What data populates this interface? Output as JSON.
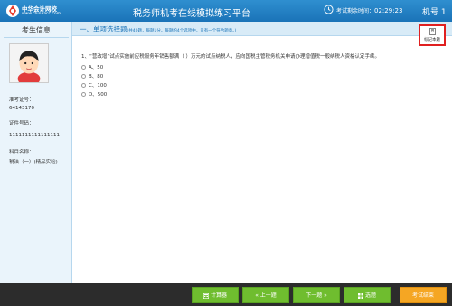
{
  "header": {
    "logo_name": "中华会计网校",
    "logo_url": "www.chinaacc.com",
    "app_title": "税务师机考在线模拟练习平台",
    "timer_label": "考试剩余时间：",
    "timer_value": "02:29:23",
    "machine_label": "机号 1"
  },
  "sidebar": {
    "title": "考生信息",
    "fields": [
      {
        "label": "准考证号：",
        "value": "64143170"
      },
      {
        "label": "证件号码：",
        "value": "1111111111111111"
      },
      {
        "label": "科目名称：",
        "value": "税法（一）(精品实验)"
      }
    ]
  },
  "section": {
    "title": "一、单项选择题",
    "note": "(共40题，每题1分。每题的4个选项中，只有一个符合题意。)"
  },
  "mark_question_label": "标记本题",
  "question": {
    "text": "1、“营改增”试点实施前应税服务年销售额满（   ）万元的试点纳税人，应向国税主管税务机关申请办理增值税一般纳税人资格认定手续。",
    "options": [
      "A、50",
      "B、80",
      "C、100",
      "D、500"
    ]
  },
  "footer": {
    "calculator": "计算器",
    "prev": "« 上一题",
    "next": "下一题 »",
    "select": "选题",
    "submit": "考试结束"
  },
  "colors": {
    "header_blue": "#1a73b8",
    "button_green": "#6fbd2f",
    "button_orange": "#f5a623",
    "highlight_red": "#e02020"
  }
}
